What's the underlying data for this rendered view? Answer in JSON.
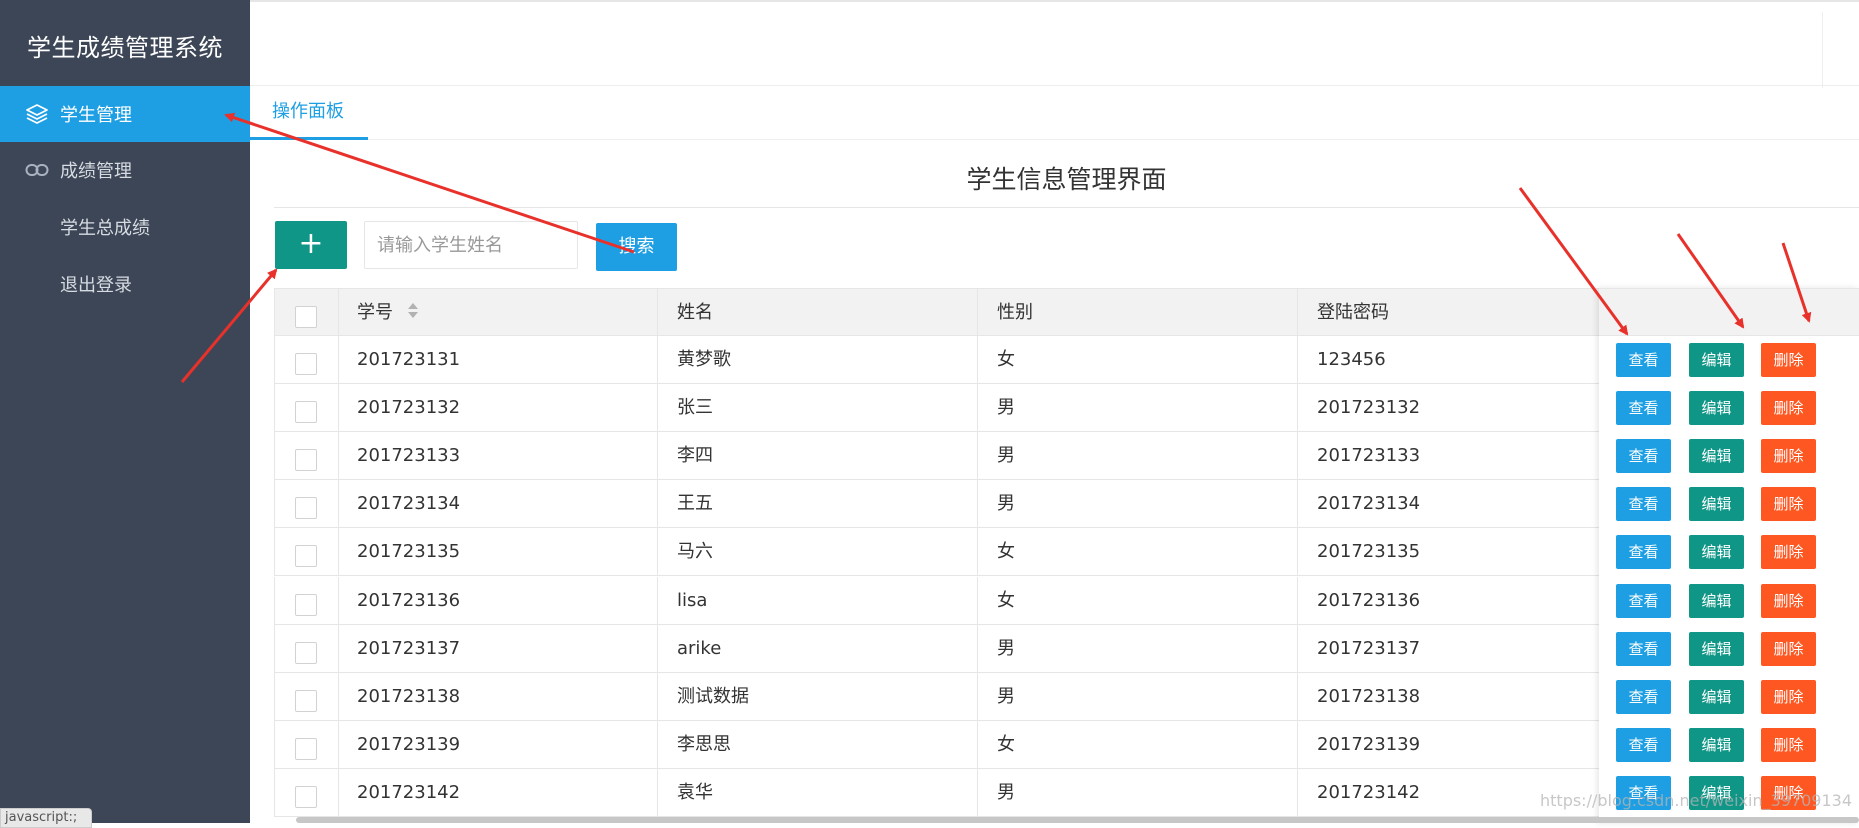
{
  "app": {
    "title": "学生成绩管理系统"
  },
  "sidebar": {
    "items": [
      {
        "label": "学生管理",
        "icon": "layers-icon",
        "active": true
      },
      {
        "label": "成绩管理",
        "icon": "link-icon",
        "active": false
      },
      {
        "label": "学生总成绩",
        "active": false
      },
      {
        "label": "退出登录",
        "active": false
      }
    ]
  },
  "tabs": [
    {
      "label": "操作面板",
      "active": true
    }
  ],
  "panel": {
    "title": "学生信息管理界面"
  },
  "toolbar": {
    "add_label": "+",
    "search_placeholder": "请输入学生姓名",
    "search_label": "搜索"
  },
  "table": {
    "headers": [
      "学号",
      "姓名",
      "性别",
      "登陆密码"
    ],
    "rows": [
      [
        "201723131",
        "黄梦歌",
        "女",
        "123456"
      ],
      [
        "201723132",
        "张三",
        "男",
        "201723132"
      ],
      [
        "201723133",
        "李四",
        "男",
        "201723133"
      ],
      [
        "201723134",
        "王五",
        "男",
        "201723134"
      ],
      [
        "201723135",
        "马六",
        "女",
        "201723135"
      ],
      [
        "201723136",
        "lisa",
        "女",
        "201723136"
      ],
      [
        "201723137",
        "arike",
        "男",
        "201723137"
      ],
      [
        "201723138",
        "测试数据",
        "男",
        "201723138"
      ],
      [
        "201723139",
        "李思思",
        "女",
        "201723139"
      ],
      [
        "201723142",
        "袁华",
        "男",
        "201723142"
      ]
    ],
    "actions": {
      "view": "查看",
      "edit": "编辑",
      "delete": "删除"
    }
  },
  "status_bar": {
    "text": "javascript:;"
  },
  "watermark": "https://blog.csdn.net/weixin_39709134",
  "colors": {
    "sidebar_bg": "#3d4656",
    "accent_blue": "#1e9fe3",
    "green": "#0f9687",
    "orange": "#ff5722",
    "annotation_red": "#e8312a"
  }
}
